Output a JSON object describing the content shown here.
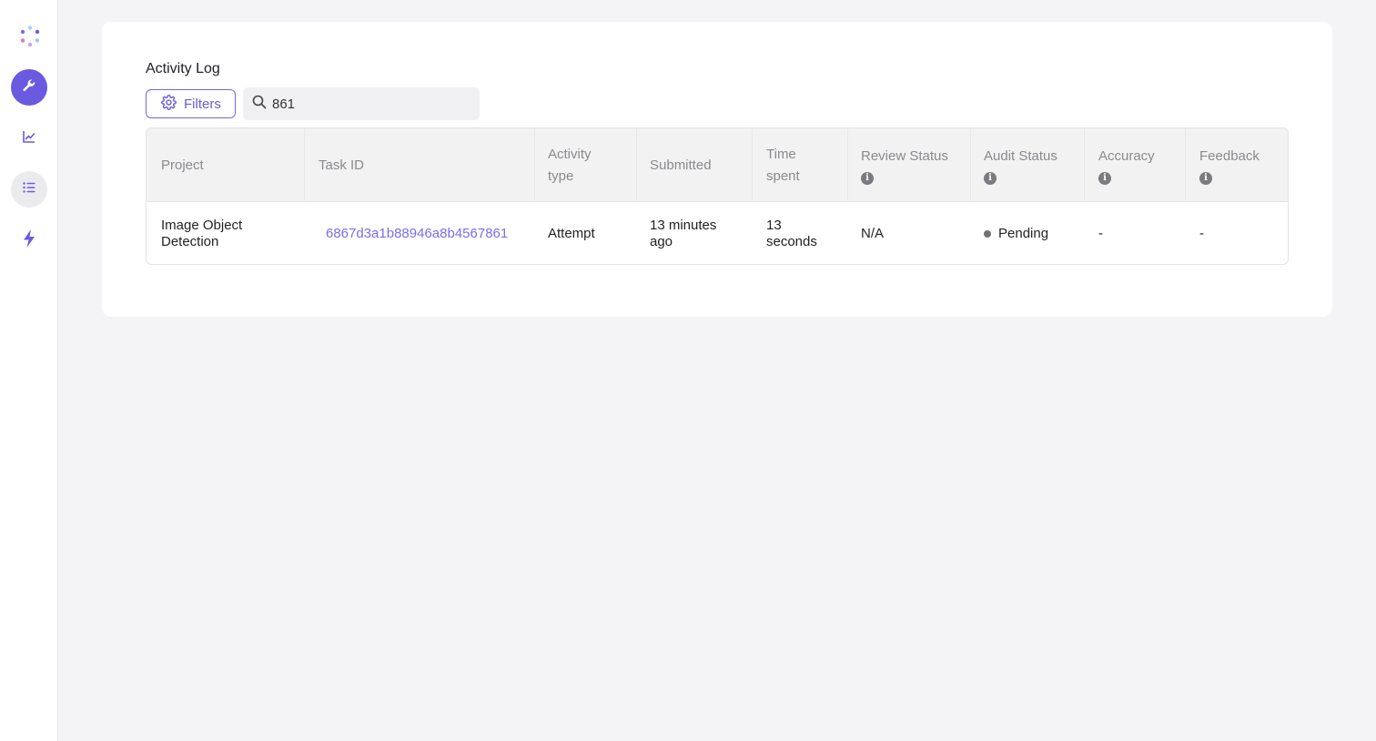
{
  "sidebar": {
    "items": [
      {
        "icon": "wrench-icon",
        "active": true
      },
      {
        "icon": "chart-line-icon",
        "active": false
      },
      {
        "icon": "list-icon",
        "active": false,
        "hovered": true
      },
      {
        "icon": "lightning-icon",
        "active": false
      }
    ],
    "accent_color": "#6a5ae0"
  },
  "activity_log": {
    "title": "Activity Log",
    "filters_label": "Filters",
    "search_value": "861",
    "columns": [
      {
        "label": "Project",
        "info": false
      },
      {
        "label": "Task ID",
        "info": false
      },
      {
        "label": "Activity type",
        "info": false
      },
      {
        "label": "Submitted",
        "info": false
      },
      {
        "label": "Time spent",
        "info": false
      },
      {
        "label": "Review Status",
        "info": true
      },
      {
        "label": "Audit Status",
        "info": true
      },
      {
        "label": "Accuracy",
        "info": true
      },
      {
        "label": "Feedback",
        "info": true
      }
    ],
    "rows": [
      {
        "project": "Image Object Detection",
        "task_id": "6867d3a1b88946a8b4567861",
        "activity_type": "Attempt",
        "submitted": "13 minutes ago",
        "time_spent": "13 seconds",
        "review_status": "N/A",
        "audit_status": "Pending",
        "accuracy": "-",
        "feedback": "-"
      }
    ]
  }
}
